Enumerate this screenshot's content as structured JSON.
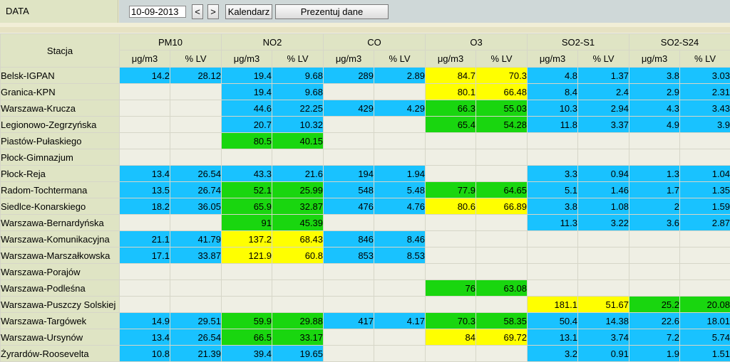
{
  "header": {
    "data_label": "DATA",
    "date_value": "10-09-2013",
    "prev_label": "<",
    "next_label": ">",
    "calendar_label": "Kalendarz",
    "show_label": "Prezentuj dane"
  },
  "table": {
    "station_header": "Stacja",
    "pollutants": [
      "PM10",
      "NO2",
      "CO",
      "O3",
      "SO2-S1",
      "SO2-S24"
    ],
    "sub_headers": [
      "μg/m3",
      "% LV"
    ],
    "colors": {
      "b": "#19c2ff",
      "g": "#19d60f",
      "y": "#ffff00",
      "e": "#efefe4"
    },
    "rows": [
      {
        "name": "Belsk-IGPAN",
        "cells": [
          "14.2",
          "28.12",
          "19.4",
          "9.68",
          "289",
          "2.89",
          "84.7",
          "70.3",
          "4.8",
          "1.37",
          "3.8",
          "3.03"
        ],
        "colors": [
          "b",
          "b",
          "b",
          "b",
          "b",
          "b",
          "y",
          "y",
          "b",
          "b",
          "b",
          "b"
        ]
      },
      {
        "name": "Granica-KPN",
        "cells": [
          "",
          "",
          "19.4",
          "9.68",
          "",
          "",
          "80.1",
          "66.48",
          "8.4",
          "2.4",
          "2.9",
          "2.31"
        ],
        "colors": [
          "e",
          "e",
          "b",
          "b",
          "e",
          "e",
          "y",
          "y",
          "b",
          "b",
          "b",
          "b"
        ]
      },
      {
        "name": "Warszawa-Krucza",
        "cells": [
          "",
          "",
          "44.6",
          "22.25",
          "429",
          "4.29",
          "66.3",
          "55.03",
          "10.3",
          "2.94",
          "4.3",
          "3.43"
        ],
        "colors": [
          "e",
          "e",
          "b",
          "b",
          "b",
          "b",
          "g",
          "g",
          "b",
          "b",
          "b",
          "b"
        ]
      },
      {
        "name": "Legionowo-Zegrzyńska",
        "cells": [
          "",
          "",
          "20.7",
          "10.32",
          "",
          "",
          "65.4",
          "54.28",
          "11.8",
          "3.37",
          "4.9",
          "3.9"
        ],
        "colors": [
          "e",
          "e",
          "b",
          "b",
          "e",
          "e",
          "g",
          "g",
          "b",
          "b",
          "b",
          "b"
        ]
      },
      {
        "name": "Piastów-Pułaskiego",
        "cells": [
          "",
          "",
          "80.5",
          "40.15",
          "",
          "",
          "",
          "",
          "",
          "",
          "",
          ""
        ],
        "colors": [
          "e",
          "e",
          "g",
          "g",
          "e",
          "e",
          "e",
          "e",
          "e",
          "e",
          "e",
          "e"
        ]
      },
      {
        "name": "Płock-Gimnazjum",
        "cells": [
          "",
          "",
          "",
          "",
          "",
          "",
          "",
          "",
          "",
          "",
          "",
          ""
        ],
        "colors": [
          "e",
          "e",
          "e",
          "e",
          "e",
          "e",
          "e",
          "e",
          "e",
          "e",
          "e",
          "e"
        ]
      },
      {
        "name": "Płock-Reja",
        "cells": [
          "13.4",
          "26.54",
          "43.3",
          "21.6",
          "194",
          "1.94",
          "",
          "",
          "3.3",
          "0.94",
          "1.3",
          "1.04"
        ],
        "colors": [
          "b",
          "b",
          "b",
          "b",
          "b",
          "b",
          "e",
          "e",
          "b",
          "b",
          "b",
          "b"
        ]
      },
      {
        "name": "Radom-Tochtermana",
        "cells": [
          "13.5",
          "26.74",
          "52.1",
          "25.99",
          "548",
          "5.48",
          "77.9",
          "64.65",
          "5.1",
          "1.46",
          "1.7",
          "1.35"
        ],
        "colors": [
          "b",
          "b",
          "g",
          "g",
          "b",
          "b",
          "g",
          "g",
          "b",
          "b",
          "b",
          "b"
        ]
      },
      {
        "name": "Siedlce-Konarskiego",
        "cells": [
          "18.2",
          "36.05",
          "65.9",
          "32.87",
          "476",
          "4.76",
          "80.6",
          "66.89",
          "3.8",
          "1.08",
          "2",
          "1.59"
        ],
        "colors": [
          "b",
          "b",
          "g",
          "g",
          "b",
          "b",
          "y",
          "y",
          "b",
          "b",
          "b",
          "b"
        ]
      },
      {
        "name": "Warszawa-Bernardyńska",
        "cells": [
          "",
          "",
          "91",
          "45.39",
          "",
          "",
          "",
          "",
          "11.3",
          "3.22",
          "3.6",
          "2.87"
        ],
        "colors": [
          "e",
          "e",
          "g",
          "g",
          "e",
          "e",
          "e",
          "e",
          "b",
          "b",
          "b",
          "b"
        ]
      },
      {
        "name": "Warszawa-Komunikacyjna",
        "cells": [
          "21.1",
          "41.79",
          "137.2",
          "68.43",
          "846",
          "8.46",
          "",
          "",
          "",
          "",
          "",
          ""
        ],
        "colors": [
          "b",
          "b",
          "y",
          "y",
          "b",
          "b",
          "e",
          "e",
          "e",
          "e",
          "e",
          "e"
        ]
      },
      {
        "name": "Warszawa-Marszałkowska",
        "cells": [
          "17.1",
          "33.87",
          "121.9",
          "60.8",
          "853",
          "8.53",
          "",
          "",
          "",
          "",
          "",
          ""
        ],
        "colors": [
          "b",
          "b",
          "y",
          "y",
          "b",
          "b",
          "e",
          "e",
          "e",
          "e",
          "e",
          "e"
        ]
      },
      {
        "name": "Warszawa-Porajów",
        "cells": [
          "",
          "",
          "",
          "",
          "",
          "",
          "",
          "",
          "",
          "",
          "",
          ""
        ],
        "colors": [
          "e",
          "e",
          "e",
          "e",
          "e",
          "e",
          "e",
          "e",
          "e",
          "e",
          "e",
          "e"
        ]
      },
      {
        "name": "Warszawa-Podleśna",
        "cells": [
          "",
          "",
          "",
          "",
          "",
          "",
          "76",
          "63.08",
          "",
          "",
          "",
          ""
        ],
        "colors": [
          "e",
          "e",
          "e",
          "e",
          "e",
          "e",
          "g",
          "g",
          "e",
          "e",
          "e",
          "e"
        ]
      },
      {
        "name": "Warszawa-Puszczy Solskiej",
        "cells": [
          "",
          "",
          "",
          "",
          "",
          "",
          "",
          "",
          "181.1",
          "51.67",
          "25.2",
          "20.08"
        ],
        "colors": [
          "e",
          "e",
          "e",
          "e",
          "e",
          "e",
          "e",
          "e",
          "y",
          "y",
          "g",
          "g"
        ]
      },
      {
        "name": "Warszawa-Targówek",
        "cells": [
          "14.9",
          "29.51",
          "59.9",
          "29.88",
          "417",
          "4.17",
          "70.3",
          "58.35",
          "50.4",
          "14.38",
          "22.6",
          "18.01"
        ],
        "colors": [
          "b",
          "b",
          "g",
          "g",
          "b",
          "b",
          "g",
          "g",
          "b",
          "b",
          "b",
          "b"
        ]
      },
      {
        "name": "Warszawa-Ursynów",
        "cells": [
          "13.4",
          "26.54",
          "66.5",
          "33.17",
          "",
          "",
          "84",
          "69.72",
          "13.1",
          "3.74",
          "7.2",
          "5.74"
        ],
        "colors": [
          "b",
          "b",
          "g",
          "g",
          "e",
          "e",
          "y",
          "y",
          "b",
          "b",
          "b",
          "b"
        ]
      },
      {
        "name": "Żyrardów-Roosevelta",
        "cells": [
          "10.8",
          "21.39",
          "39.4",
          "19.65",
          "",
          "",
          "",
          "",
          "3.2",
          "0.91",
          "1.9",
          "1.51"
        ],
        "colors": [
          "b",
          "b",
          "b",
          "b",
          "e",
          "e",
          "e",
          "e",
          "b",
          "b",
          "b",
          "b"
        ]
      }
    ]
  }
}
